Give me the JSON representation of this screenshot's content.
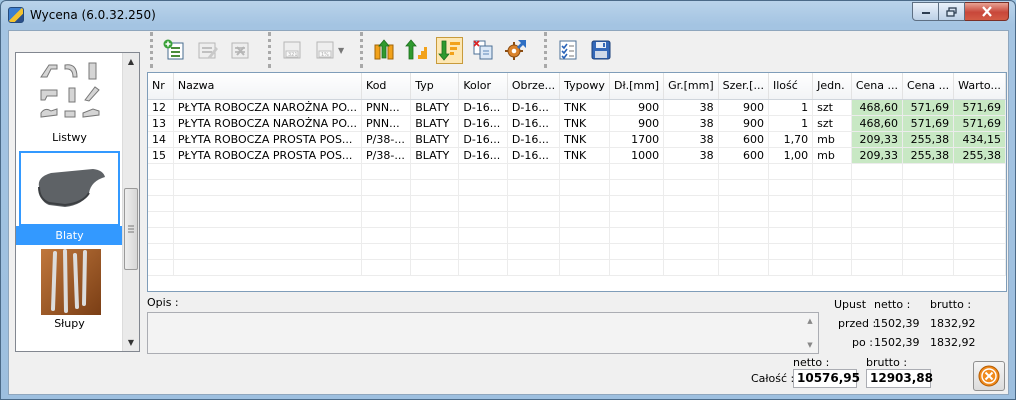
{
  "window": {
    "title": "Wycena (6.0.32.250)"
  },
  "categories": [
    {
      "label": "Listwy",
      "selected": false
    },
    {
      "label": "Blaty",
      "selected": true
    },
    {
      "label": "Słupy",
      "selected": false
    }
  ],
  "table": {
    "columns": [
      "Nr",
      "Nazwa",
      "Kod",
      "Typ",
      "Kolor",
      "Obrze...",
      "Typowy",
      "Dł.[mm]",
      "Gr.[mm]",
      "Szer.[...",
      "Ilość",
      "Jedn.",
      "Cena ...",
      "Cena ...",
      "Warto..."
    ],
    "rows": [
      [
        "12",
        "PŁYTA ROBOCZA NAROŻNA PO...",
        "PNN...",
        "BLATY",
        "D-16...",
        "D-16...",
        "TNK",
        "900",
        "38",
        "900",
        "1",
        "szt",
        "468,60",
        "571,69",
        "571,69"
      ],
      [
        "13",
        "PŁYTA ROBOCZA NAROŻNA PO...",
        "PNN...",
        "BLATY",
        "D-16...",
        "D-16...",
        "TNK",
        "900",
        "38",
        "900",
        "1",
        "szt",
        "468,60",
        "571,69",
        "571,69"
      ],
      [
        "14",
        "PŁYTA ROBOCZA PROSTA POS...",
        "P/38-...",
        "BLATY",
        "D-16...",
        "D-16...",
        "TNK",
        "1700",
        "38",
        "600",
        "1,70",
        "mb",
        "209,33",
        "255,38",
        "434,15"
      ],
      [
        "15",
        "PŁYTA ROBOCZA PROSTA POS...",
        "P/38-...",
        "BLATY",
        "D-16...",
        "D-16...",
        "TNK",
        "1000",
        "38",
        "600",
        "1,00",
        "mb",
        "209,33",
        "255,38",
        "255,38"
      ]
    ]
  },
  "opis": {
    "label": "Opis :",
    "value": ""
  },
  "summary": {
    "upust_label": "Upust",
    "netto_label": "netto :",
    "brutto_label": "brutto :",
    "przed_label": "przed :",
    "przed_netto": "1502,39",
    "przed_brutto": "1832,92",
    "po_label": "po :",
    "po_netto": "1502,39",
    "po_brutto": "1832,92"
  },
  "totals": {
    "netto_label": "netto :",
    "brutto_label": "brutto :",
    "calosc_label": "Całość :",
    "netto": "10576,95",
    "brutto": "12903,88"
  },
  "colors": {
    "accent": "#3399ff",
    "price_cell": "#c8e8c4",
    "exit_orange": "#f08a1c"
  }
}
